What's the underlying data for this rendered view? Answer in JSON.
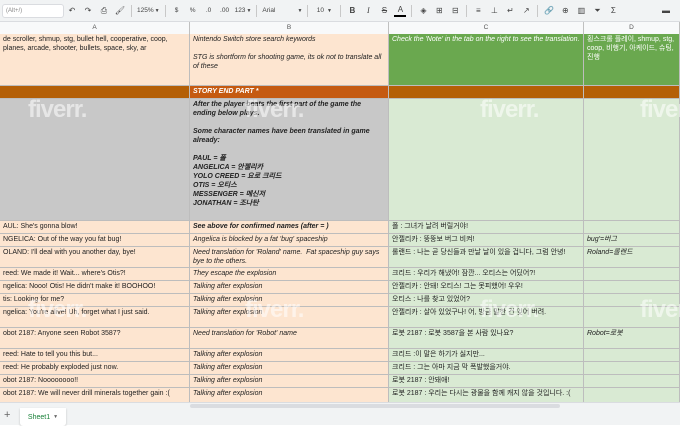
{
  "toolbar": {
    "search_placeholder": "(Alt+/)",
    "zoom": "125%",
    "currency": "$",
    "percent": "%",
    "dec_decrease": ".0",
    "dec_increase": ".00",
    "number_format": "123",
    "font": "Arial",
    "font_size": "10",
    "bold": "B",
    "italic": "I",
    "strike": "S",
    "text_color": "A"
  },
  "columns": [
    "A",
    "B",
    "C",
    "D"
  ],
  "rows": [
    {
      "a": "de scroller, shmup, stg, bullet hell, cooperative, coop, planes, arcade, shooter, bullets, space, sky, ar",
      "b": "Nintendo Switch store search keywords\n\nSTG is shortform for shooting game, its ok not to translate all of these",
      "c": "Check the 'Note' in the tab on the right to see the translation.",
      "d": "횡스크롤 플레이, shmup, stg, coop, 비행기, 아케이드, 슈팅, 진행"
    },
    {
      "a": "",
      "b": "STORY END PART *",
      "c": "",
      "d": ""
    },
    {
      "a": "",
      "b": "After the player beats the first part of the game the ending below plays.\n\nSome character names have been translated in game already:\n\nPAUL = 폴\nANGELICA = 안젤리카\nYOLO CREED = 요로 크리드\nOTIS = 오티스\nMESSENGER = 메신저\nJONATHAN = 조나탄",
      "c": "",
      "d": ""
    },
    {
      "a": "AUL: She's gonna blow!",
      "b": "See above for confirmed names (after = )",
      "c": "폴 : 그녀가 날려 버릴거야!",
      "d": ""
    },
    {
      "a": "NGELICA: Out of the way you fat bug!",
      "b": "Angelica is blocked by a fat 'bug' spaceship",
      "c": "안젤리카 : 뚱뚱보 버그 비켜!",
      "d": "bug'=버그"
    },
    {
      "a": "OLAND: I'll deal with you another day, bye!",
      "b": "Need translation for 'Roland' name.  Fat spaceship guy says bye to the others.",
      "c": "롤랜드 : 나는 곧 당신들과 만날 날이 있을 겁니다, 그럼 안녕!",
      "d": "Roland=롤랜드"
    },
    {
      "a": "reed: We made it! Wait... where's Otis?!",
      "b": "They escape the explosion",
      "c": "크리드 : 우리가 해냈어! 잠깐... 오티스는 어딨어?!",
      "d": ""
    },
    {
      "a": "ngelica: Nooo! Otis! He didn't make it! BOOHOO!",
      "b": "Talking after explosion",
      "c": "안젤리카 : 안돼! 오티스! 그는 못피했어! 우우!",
      "d": ""
    },
    {
      "a": "tis: Looking for me?",
      "b": "Talking after explosion",
      "c": "오티스 : 나를 찾고 있었어?",
      "d": ""
    },
    {
      "a": "ngelica: You're alive! Uh, forget what I just said.",
      "b": "Talking after explosion",
      "c": "안젤리카 : 살아 있었구나! 어, 방금 말한 건 잊어 버려.",
      "d": ""
    },
    {
      "a": "obot 2187: Anyone seen Robot 3587?",
      "b": "Need translation for 'Robot' name",
      "c": "로봇 2187 : 로봇 3587을 본 사람 있나요?",
      "d": "Robot=로봇"
    },
    {
      "a": "reed: Hate to tell you this but...",
      "b": "Talking after explosion",
      "c": "크리드 :이 말은 하기가 싫지만...",
      "d": ""
    },
    {
      "a": "reed: He probably exploded just now.",
      "b": "Talking after explosion",
      "c": "크리드 : 그는 아마 지금 막 폭발했을거야.",
      "d": ""
    },
    {
      "a": "obot 2187: Noooooooo!!",
      "b": "Talking after explosion",
      "c": "로봇 2187 : 안돼애!",
      "d": ""
    },
    {
      "a": "obot 2187: We will never drill minerals together gain :(",
      "b": "Talking after explosion",
      "c": "로봇 2187 : 우리는 다시는 광물을 함께 캐지 않을 것입니다. :(",
      "d": ""
    }
  ],
  "watermarks": [
    "fiverr.",
    "fiverr.",
    "fiverr.",
    "fiverr.",
    "fiverr.",
    "fiverr.",
    "fiverr.",
    "fiverr."
  ],
  "footer": {
    "add_sheet": "+",
    "sheet_list": "≡",
    "sheet_tab": "Sheet1"
  },
  "colors": {
    "peach": "#fde5d0",
    "grey": "#c8c8c8",
    "green_header": "#6aa84f",
    "light_green": "#d9ead3",
    "story_band": "#c55a11",
    "orange_band": "#b45f06"
  }
}
